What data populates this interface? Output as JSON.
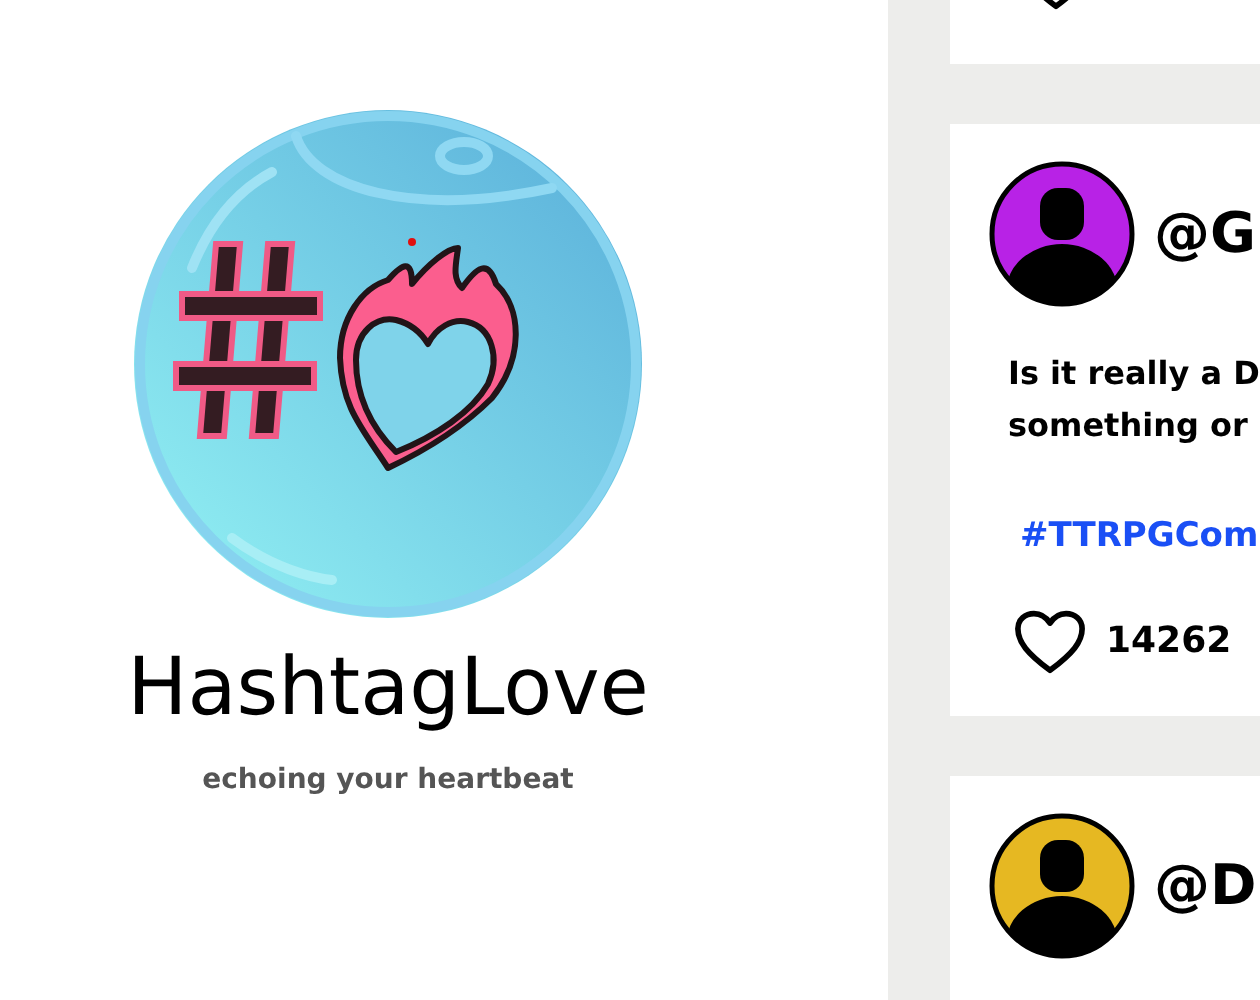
{
  "profile": {
    "name": "HashtagLove",
    "tagline": "echoing your heartbeat"
  },
  "posts": [
    {
      "color": "#b822e6",
      "handle": "@G",
      "text_lines": [
        "Is it really a D",
        "something or"
      ],
      "hashtag": "#TTRPGCom",
      "likes": "14262"
    },
    {
      "color": "#e6b822",
      "handle": "@D"
    }
  ]
}
